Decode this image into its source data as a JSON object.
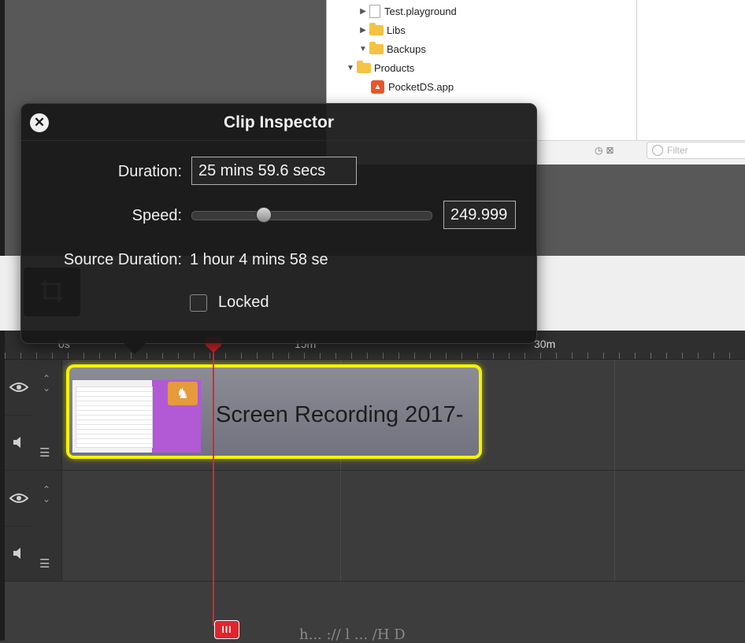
{
  "project_tree": {
    "items": [
      {
        "label": "Test.playground",
        "kind": "file",
        "expanded": false
      },
      {
        "label": "Libs",
        "kind": "folder",
        "expanded": false
      },
      {
        "label": "Backups",
        "kind": "folder",
        "expanded": true
      },
      {
        "label": "Products",
        "kind": "folder",
        "expanded": true
      },
      {
        "label": "PocketDS.app",
        "kind": "app",
        "expanded": false
      }
    ],
    "filter_placeholder": "Filter"
  },
  "inspector": {
    "title": "Clip Inspector",
    "close_icon": "close-icon",
    "duration_label": "Duration:",
    "duration_value": "25 mins 59.6 secs",
    "speed_label": "Speed:",
    "speed_value": "249.999",
    "speed_slider_level": 0.3,
    "source_duration_label": "Source Duration:",
    "source_duration_value": "1 hour 4 mins 58 se",
    "locked_label": "Locked",
    "locked_checked": false
  },
  "ruler": {
    "labels": [
      "0s",
      "15m",
      "30m"
    ]
  },
  "timeline": {
    "clip_title": "Screen Recording 2017-",
    "clip_selected_color": "#f3f300",
    "playhead_color": "#e2242c",
    "playhead_handle_label": "III"
  },
  "watermark": "h...  ://  l  ...  /H  D"
}
